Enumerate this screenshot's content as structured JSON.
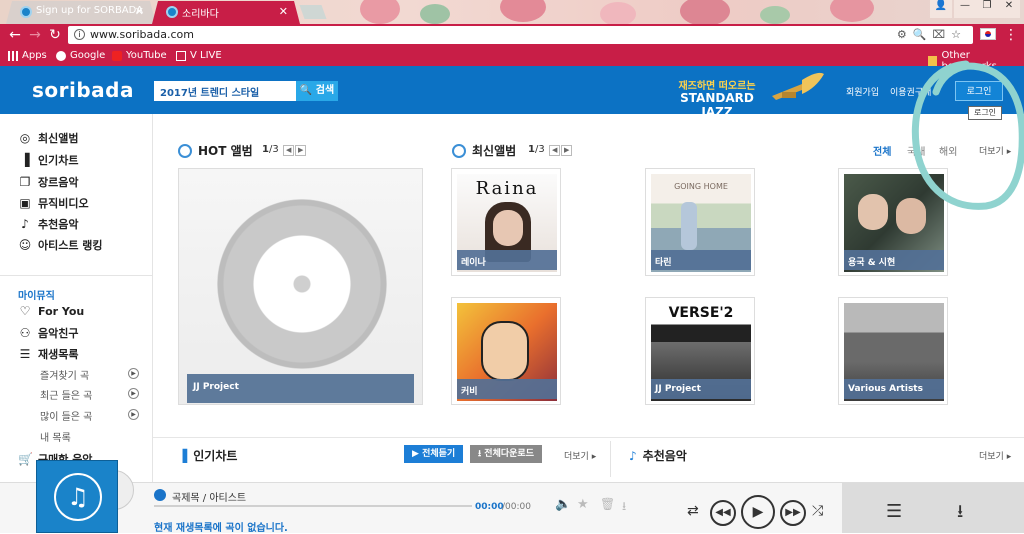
{
  "browser": {
    "tabs": [
      {
        "title": "Sign up for SORBADA",
        "active": false
      },
      {
        "title": "소리바다",
        "active": true
      }
    ],
    "url": "www.soribada.com",
    "bookmarks": [
      "Apps",
      "Google",
      "YouTube",
      "V LIVE"
    ],
    "other_bookmarks": "Other bookmarks"
  },
  "header": {
    "logo": "soribada",
    "search_value": "2017년 트렌디 스타일",
    "search_button": "검색",
    "banner_line1": "재즈하면 떠오르는",
    "banner_line2": "STANDARD JAZZ",
    "link_signup": "회원가입",
    "link_pass": "이용권구매",
    "login_button": "로그인",
    "login_tooltip": "로그인"
  },
  "sidebar": {
    "main_items": [
      {
        "label": "최신앨범",
        "icon": "disc-icon"
      },
      {
        "label": "인기차트",
        "icon": "bar-chart-icon"
      },
      {
        "label": "장르음악",
        "icon": "stack-icon"
      },
      {
        "label": "뮤직비디오",
        "icon": "play-box-icon"
      },
      {
        "label": "추천음악",
        "icon": "music-note-icon"
      },
      {
        "label": "아티스트 랭킹",
        "icon": "people-icon"
      }
    ],
    "mymusic_title": "마이뮤직",
    "my_items": [
      {
        "label": "For You",
        "icon": "heart-icon"
      },
      {
        "label": "음악친구",
        "icon": "person-icon"
      },
      {
        "label": "재생목록",
        "icon": "list-icon"
      }
    ],
    "sub_items": [
      "즐겨찾기 곡",
      "최근 들은 곡",
      "많이 들은 곡",
      "내 목록"
    ],
    "purchase": "구매한 음악"
  },
  "hot": {
    "title": "HOT 앨범",
    "page": "1",
    "total": "/3",
    "album_artist": "JJ Project"
  },
  "latest": {
    "title": "최신앨범",
    "page": "1",
    "total": "/3",
    "filters": [
      "전체",
      "국내",
      "해외"
    ],
    "more": "더보기",
    "albums": [
      {
        "artist": "레이나",
        "art_text": "Raina"
      },
      {
        "artist": "타린",
        "art_text": "GOING HOME"
      },
      {
        "artist": "용국 & 시현",
        "art_text": ""
      },
      {
        "artist": "커비",
        "art_text": ""
      },
      {
        "artist": "JJ Project",
        "art_text": "VERSE'2"
      },
      {
        "artist": "Various Artists",
        "art_text": ""
      }
    ]
  },
  "chart": {
    "title": "인기차트",
    "listen_all": "전체듣기",
    "download_all": "전체다운로드",
    "more": "더보기"
  },
  "recommend": {
    "title": "추천음악",
    "more": "더보기"
  },
  "player": {
    "track": "곡제목 / 아티스트",
    "time_current": "00:00",
    "time_total": "/00:00",
    "empty_message": "현재 재생목록에 곡이 없습니다."
  },
  "colors": {
    "brand_blue": "#0c72c4",
    "chrome_red": "#c81e47",
    "annotation": "#8fd3cf"
  }
}
